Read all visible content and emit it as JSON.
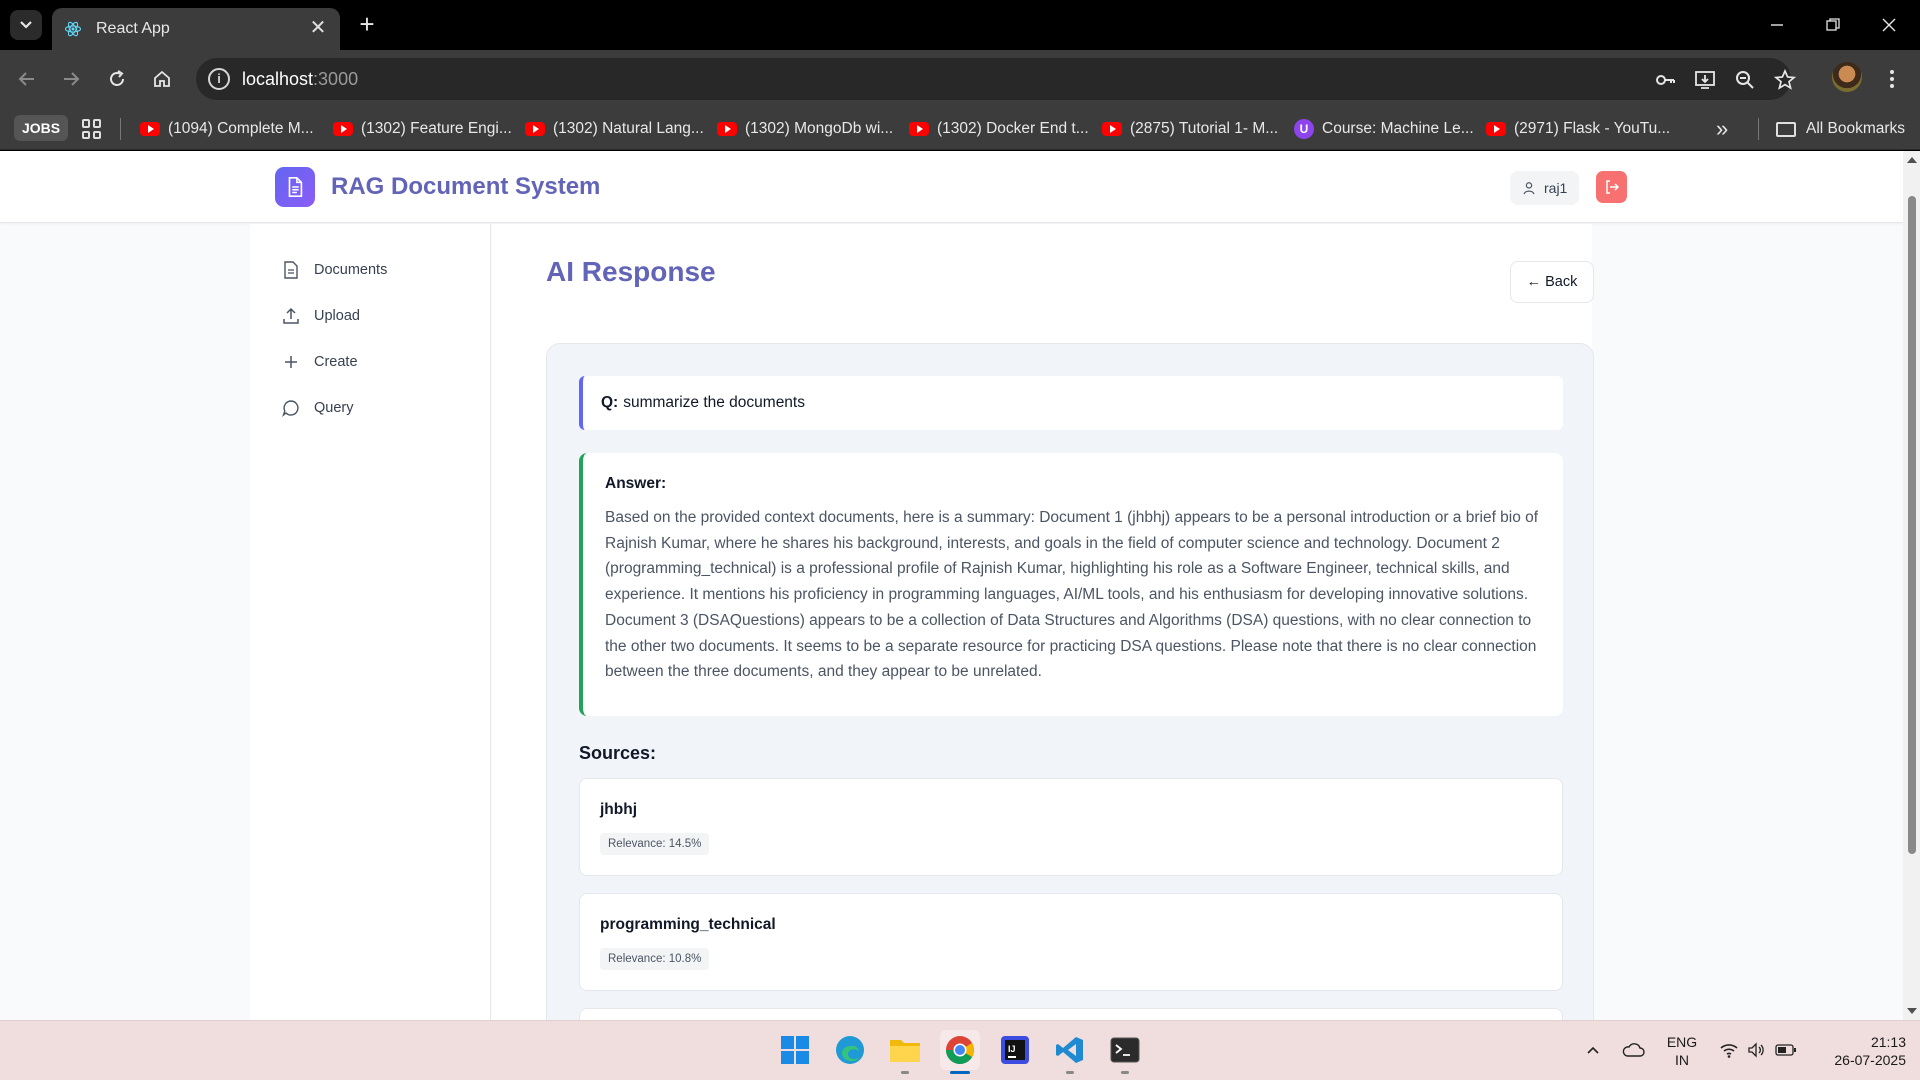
{
  "browser": {
    "tab_title": "React App",
    "url_host": "localhost",
    "url_port": ":3000",
    "bookmarks": [
      {
        "label": "JOBS"
      },
      {
        "label": "(1094) Complete M..."
      },
      {
        "label": "(1302) Feature Engi..."
      },
      {
        "label": "(1302) Natural Lang..."
      },
      {
        "label": "(1302) MongoDb wi..."
      },
      {
        "label": "(1302) Docker End t..."
      },
      {
        "label": "(2875) Tutorial 1- M..."
      },
      {
        "label": "Course: Machine Le..."
      },
      {
        "label": "(2971) Flask - YouTu..."
      },
      {
        "label": "All Bookmarks"
      }
    ]
  },
  "app": {
    "title": "RAG Document System",
    "user": "raj1",
    "accent": "#6366f1",
    "logout_color": "#f87171"
  },
  "sidebar": {
    "items": [
      {
        "label": "Documents",
        "icon": "document-icon"
      },
      {
        "label": "Upload",
        "icon": "upload-icon"
      },
      {
        "label": "Create",
        "icon": "plus-icon"
      },
      {
        "label": "Query",
        "icon": "chat-icon"
      }
    ]
  },
  "main": {
    "title": "AI Response",
    "back_label": "← Back",
    "question_prefix": "Q:",
    "question": "summarize the documents",
    "answer_heading": "Answer:",
    "answer": "Based on the provided context documents, here is a summary: Document 1 (jhbhj) appears to be a personal introduction or a brief bio of Rajnish Kumar, where he shares his background, interests, and goals in the field of computer science and technology. Document 2 (programming_technical) is a professional profile of Rajnish Kumar, highlighting his role as a Software Engineer, technical skills, and experience. It mentions his proficiency in programming languages, AI/ML tools, and his enthusiasm for developing innovative solutions. Document 3 (DSAQuestions) appears to be a collection of Data Structures and Algorithms (DSA) questions, with no clear connection to the other two documents. It seems to be a separate resource for practicing DSA questions. Please note that there is no clear connection between the three documents, and they appear to be unrelated.",
    "sources_heading": "Sources:",
    "sources": [
      {
        "title": "jhbhj",
        "relevance": "Relevance: 14.5%"
      },
      {
        "title": "programming_technical",
        "relevance": "Relevance: 10.8%"
      }
    ]
  },
  "taskbar": {
    "language": "ENG",
    "region": "IN",
    "time": "21:13",
    "date": "26-07-2025"
  }
}
